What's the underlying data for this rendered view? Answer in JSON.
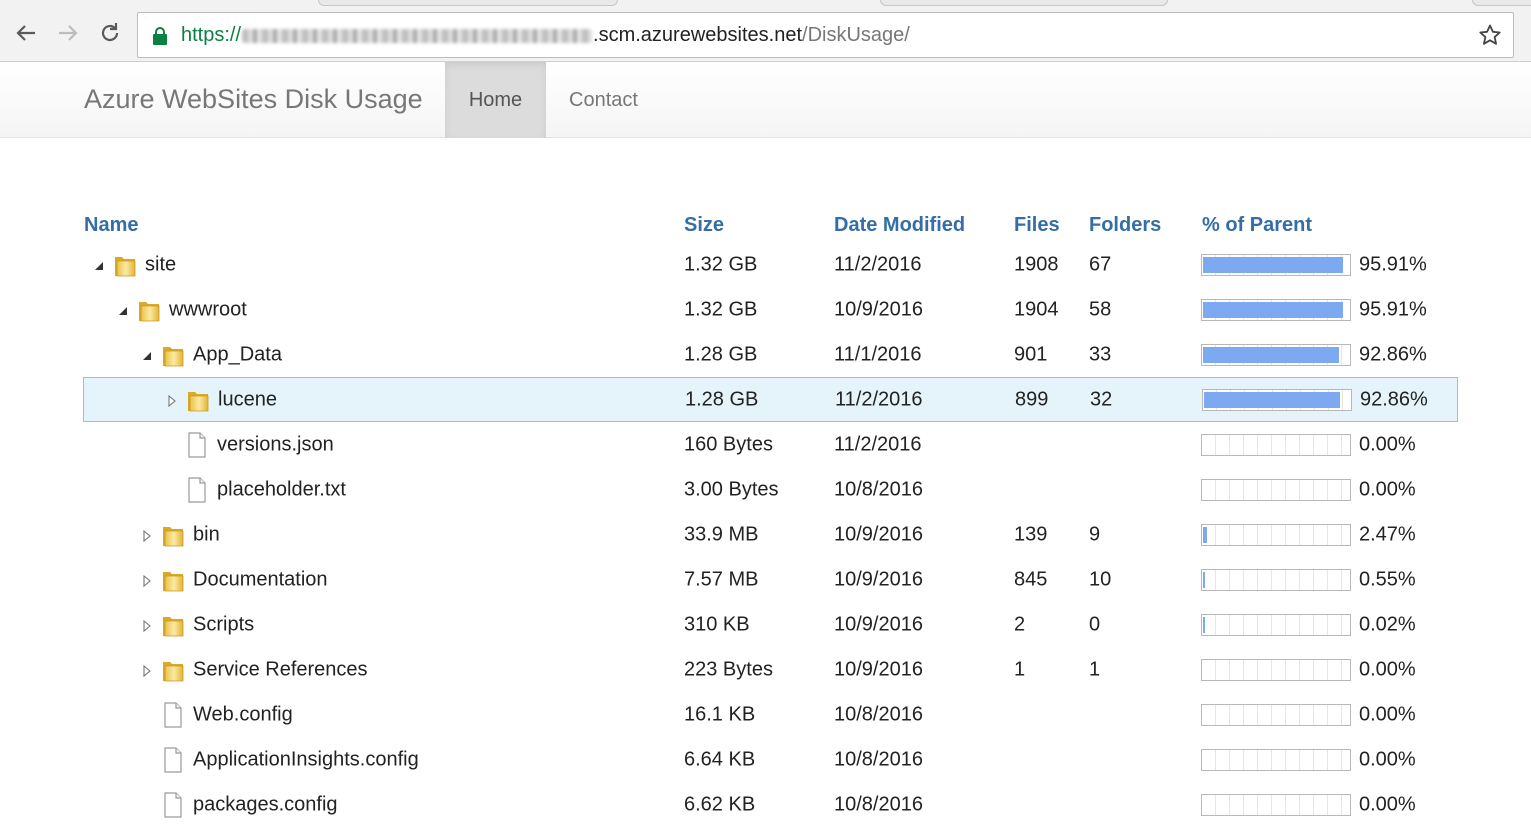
{
  "browser": {
    "url_scheme": "https://",
    "url_host": ".scm.azurewebsites.net",
    "url_path": "/DiskUsage/"
  },
  "navbar": {
    "brand": "Azure WebSites Disk Usage",
    "links": [
      {
        "label": "Home",
        "active": true
      },
      {
        "label": "Contact",
        "active": false
      }
    ]
  },
  "table": {
    "headers": [
      "Name",
      "Size",
      "Date Modified",
      "Files",
      "Folders",
      "% of Parent"
    ],
    "rows": [
      {
        "name": "site",
        "type": "folder",
        "depth": 0,
        "expander": "expanded",
        "size": "1.32 GB",
        "date": "11/2/2016",
        "files": "1908",
        "folders": "67",
        "pct_label": "95.91%",
        "pct": 95.91,
        "selected": false
      },
      {
        "name": "wwwroot",
        "type": "folder",
        "depth": 1,
        "expander": "expanded",
        "size": "1.32 GB",
        "date": "10/9/2016",
        "files": "1904",
        "folders": "58",
        "pct_label": "95.91%",
        "pct": 95.91,
        "selected": false
      },
      {
        "name": "App_Data",
        "type": "folder",
        "depth": 2,
        "expander": "expanded",
        "size": "1.28 GB",
        "date": "11/1/2016",
        "files": "901",
        "folders": "33",
        "pct_label": "92.86%",
        "pct": 92.86,
        "selected": false
      },
      {
        "name": "lucene",
        "type": "folder",
        "depth": 3,
        "expander": "collapsed",
        "size": "1.28 GB",
        "date": "11/2/2016",
        "files": "899",
        "folders": "32",
        "pct_label": "92.86%",
        "pct": 92.86,
        "selected": true
      },
      {
        "name": "versions.json",
        "type": "file",
        "depth": 3,
        "expander": "none",
        "size": "160 Bytes",
        "date": "11/2/2016",
        "files": "",
        "folders": "",
        "pct_label": "0.00%",
        "pct": 0,
        "selected": false
      },
      {
        "name": "placeholder.txt",
        "type": "file",
        "depth": 3,
        "expander": "none",
        "size": "3.00 Bytes",
        "date": "10/8/2016",
        "files": "",
        "folders": "",
        "pct_label": "0.00%",
        "pct": 0,
        "selected": false
      },
      {
        "name": "bin",
        "type": "folder",
        "depth": 2,
        "expander": "collapsed",
        "size": "33.9 MB",
        "date": "10/9/2016",
        "files": "139",
        "folders": "9",
        "pct_label": "2.47%",
        "pct": 2.47,
        "selected": false
      },
      {
        "name": "Documentation",
        "type": "folder",
        "depth": 2,
        "expander": "collapsed",
        "size": "7.57 MB",
        "date": "10/9/2016",
        "files": "845",
        "folders": "10",
        "pct_label": "0.55%",
        "pct": 0.55,
        "selected": false
      },
      {
        "name": "Scripts",
        "type": "folder",
        "depth": 2,
        "expander": "collapsed",
        "size": "310 KB",
        "date": "10/9/2016",
        "files": "2",
        "folders": "0",
        "pct_label": "0.02%",
        "pct": 0.02,
        "selected": false
      },
      {
        "name": "Service References",
        "type": "folder",
        "depth": 2,
        "expander": "collapsed",
        "size": "223 Bytes",
        "date": "10/9/2016",
        "files": "1",
        "folders": "1",
        "pct_label": "0.00%",
        "pct": 0,
        "selected": false
      },
      {
        "name": "Web.config",
        "type": "file",
        "depth": 2,
        "expander": "none",
        "size": "16.1 KB",
        "date": "10/8/2016",
        "files": "",
        "folders": "",
        "pct_label": "0.00%",
        "pct": 0,
        "selected": false
      },
      {
        "name": "ApplicationInsights.config",
        "type": "file",
        "depth": 2,
        "expander": "none",
        "size": "6.64 KB",
        "date": "10/8/2016",
        "files": "",
        "folders": "",
        "pct_label": "0.00%",
        "pct": 0,
        "selected": false
      },
      {
        "name": "packages.config",
        "type": "file",
        "depth": 2,
        "expander": "none",
        "size": "6.62 KB",
        "date": "10/8/2016",
        "files": "",
        "folders": "",
        "pct_label": "0.00%",
        "pct": 0,
        "selected": false
      }
    ]
  },
  "colors": {
    "header_text": "#336ea8",
    "bar_fill": "#7ca9f0",
    "selection_bg": "#e5f3fb",
    "selection_border": "#7ecfd9",
    "secure_green": "#0b8043"
  },
  "icons": {
    "back": "arrow-left-icon",
    "forward": "arrow-right-icon",
    "reload": "reload-icon",
    "secure": "lock-icon",
    "bookmark": "star-icon",
    "folder": "folder-icon",
    "file": "file-icon"
  }
}
